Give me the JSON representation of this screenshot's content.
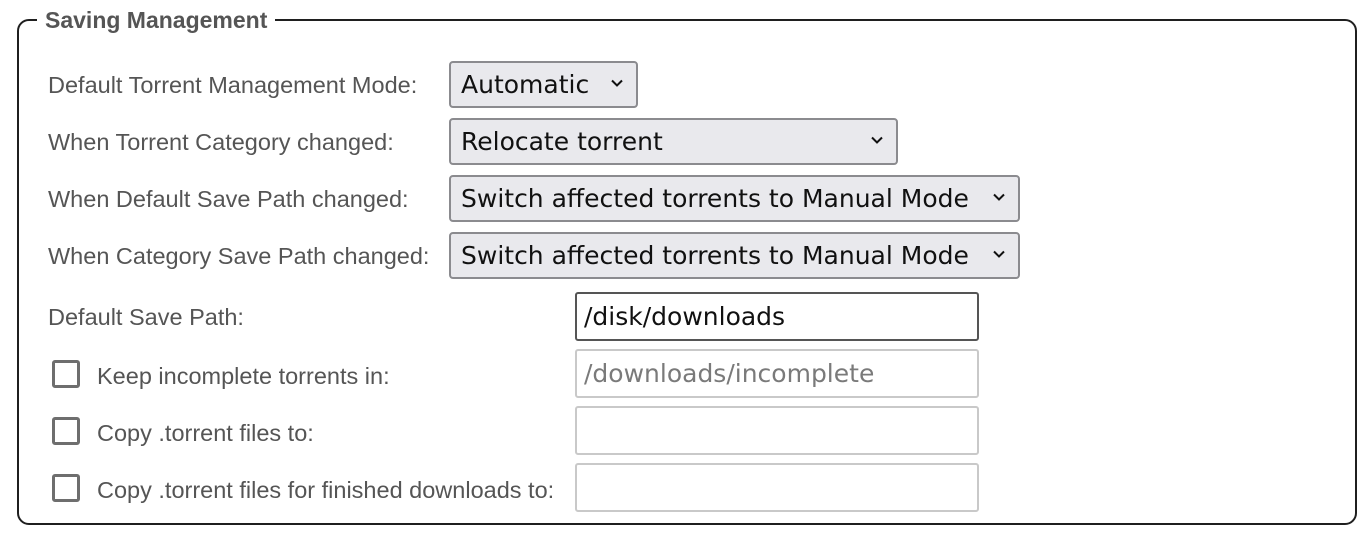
{
  "section": {
    "title": "Saving Management"
  },
  "rows": {
    "management_mode": {
      "label": "Default Torrent Management Mode:",
      "value": "Automatic"
    },
    "category_changed": {
      "label": "When Torrent Category changed:",
      "value": "Relocate torrent"
    },
    "default_path_changed": {
      "label": "When Default Save Path changed:",
      "value": "Switch affected torrents to Manual Mode"
    },
    "category_path_changed": {
      "label": "When Category Save Path changed:",
      "value": "Switch affected torrents to Manual Mode"
    },
    "default_save_path": {
      "label": "Default Save Path:",
      "value": "/disk/downloads"
    },
    "keep_incomplete": {
      "label": "Keep incomplete torrents in:",
      "checked": false,
      "value": "/downloads/incomplete"
    },
    "copy_torrent": {
      "label": "Copy .torrent files to:",
      "checked": false,
      "value": ""
    },
    "copy_torrent_finished": {
      "label": "Copy .torrent files for finished downloads to:",
      "checked": false,
      "value": ""
    }
  },
  "icons": {
    "dropdown": "chevron-down-icon"
  },
  "colors": {
    "label_text": "#555555",
    "select_bg": "#e9e9ed",
    "border": "#1f1f1f"
  }
}
